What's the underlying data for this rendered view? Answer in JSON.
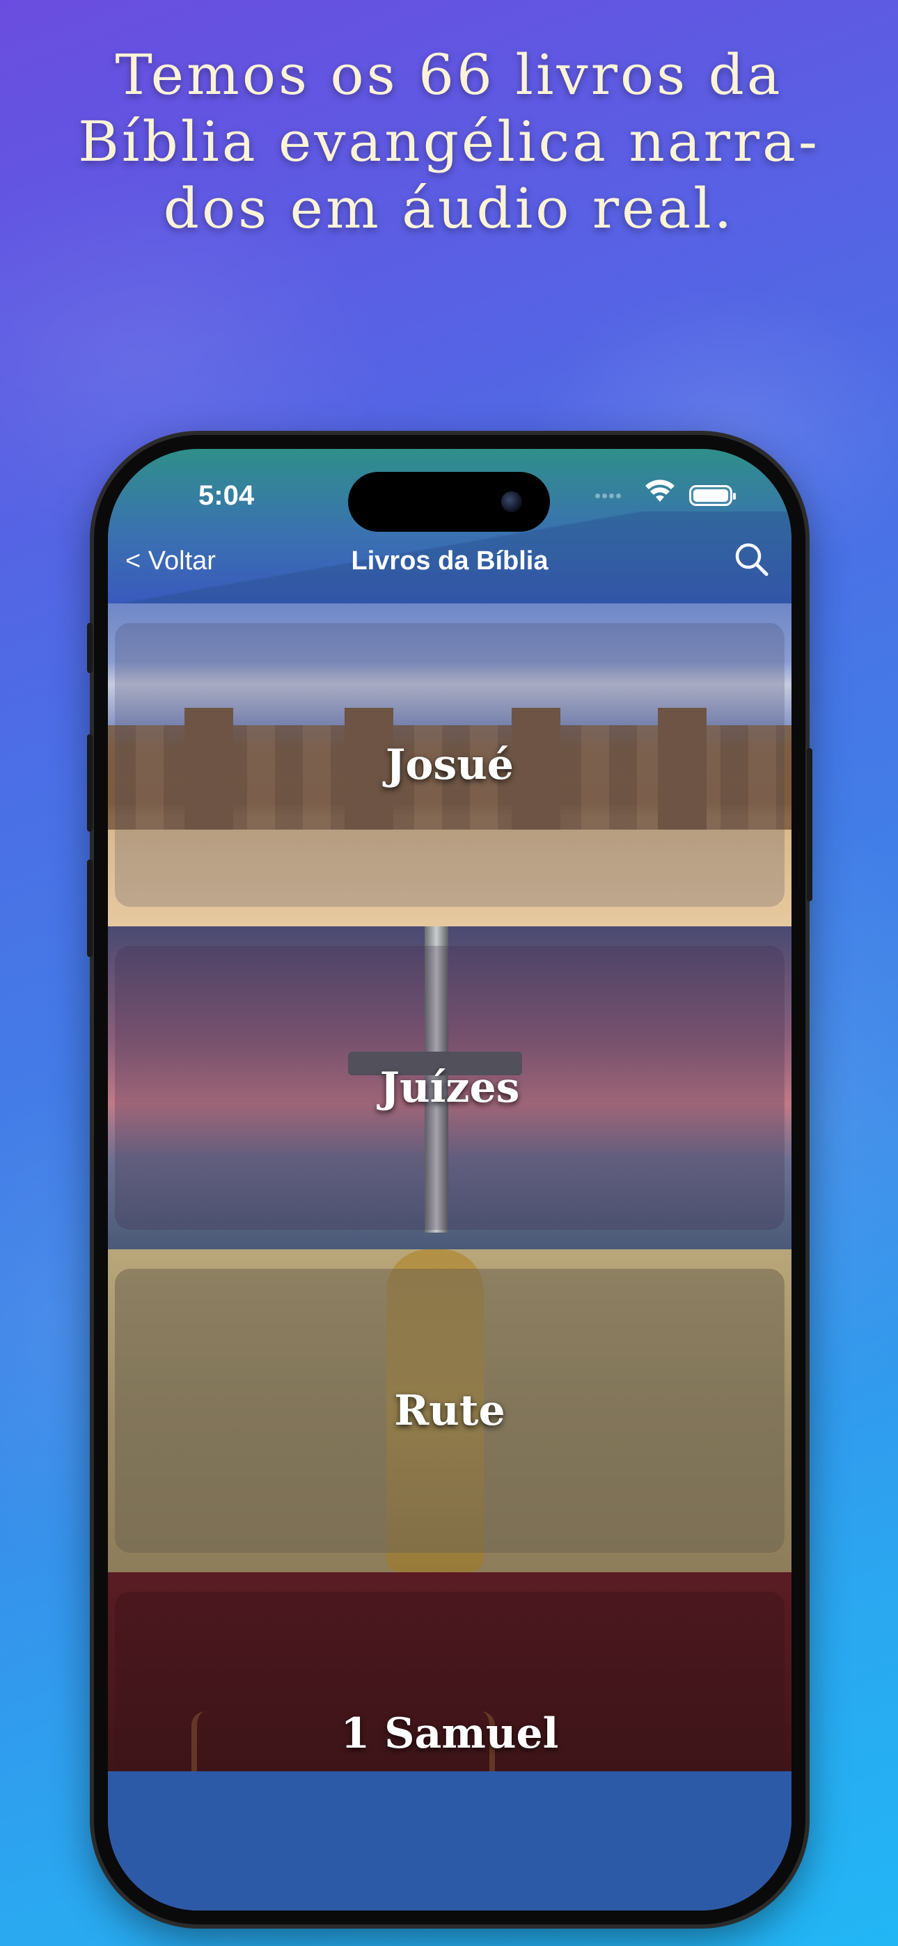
{
  "headline": {
    "line1": "Temos os 66 livros da",
    "line2": "Bíblia evangélica narra-",
    "line3": "dos em áudio real."
  },
  "status_bar": {
    "time": "5:04"
  },
  "nav": {
    "back_label": "< Voltar",
    "title": "Livros da Bíblia",
    "search_icon": "search-icon"
  },
  "books": [
    {
      "label": "Josué"
    },
    {
      "label": "Juízes"
    },
    {
      "label": "Rute"
    },
    {
      "label": "1 Samuel"
    }
  ],
  "colors": {
    "headline_text": "#fbf3d6",
    "background_top": "#6a4de0",
    "background_bottom": "#22b6f5"
  }
}
